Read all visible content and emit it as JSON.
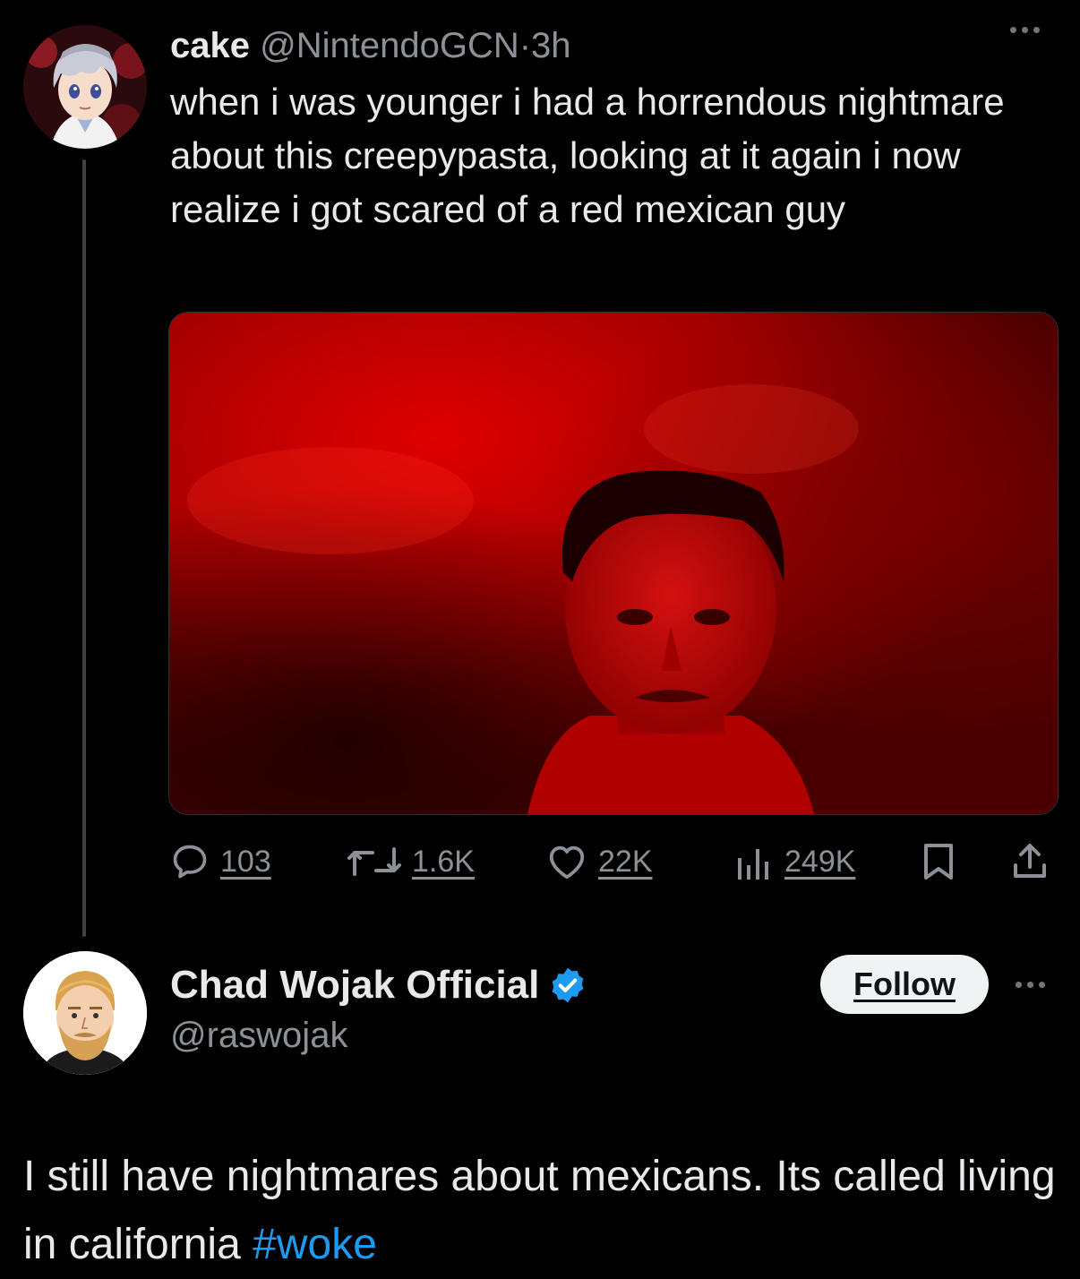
{
  "tweet1": {
    "display_name": "cake",
    "handle": "@NintendoGCN",
    "separator": "·",
    "time": "3h",
    "text": "when i was younger i had a horrendous nightmare about this creepypasta, looking at it again i now realize i got scared of a red mexican guy",
    "media": {
      "icon": "red-photo-of-man",
      "colors": {
        "dominant": "#c00000",
        "dark": "#2a0000"
      }
    },
    "actions": {
      "replies": "103",
      "retweets": "1.6K",
      "likes": "22K",
      "views": "249K"
    }
  },
  "tweet2": {
    "display_name": "Chad Wojak Official",
    "verified": true,
    "handle": "@raswojak",
    "follow_label": "Follow",
    "text": "I still have nightmares about mexicans. Its called living in california",
    "hashtag": "#woke"
  },
  "colors": {
    "background": "#000000",
    "text": "#e7e9ea",
    "secondary": "#8b9196",
    "accent": "#1d9bf0"
  }
}
